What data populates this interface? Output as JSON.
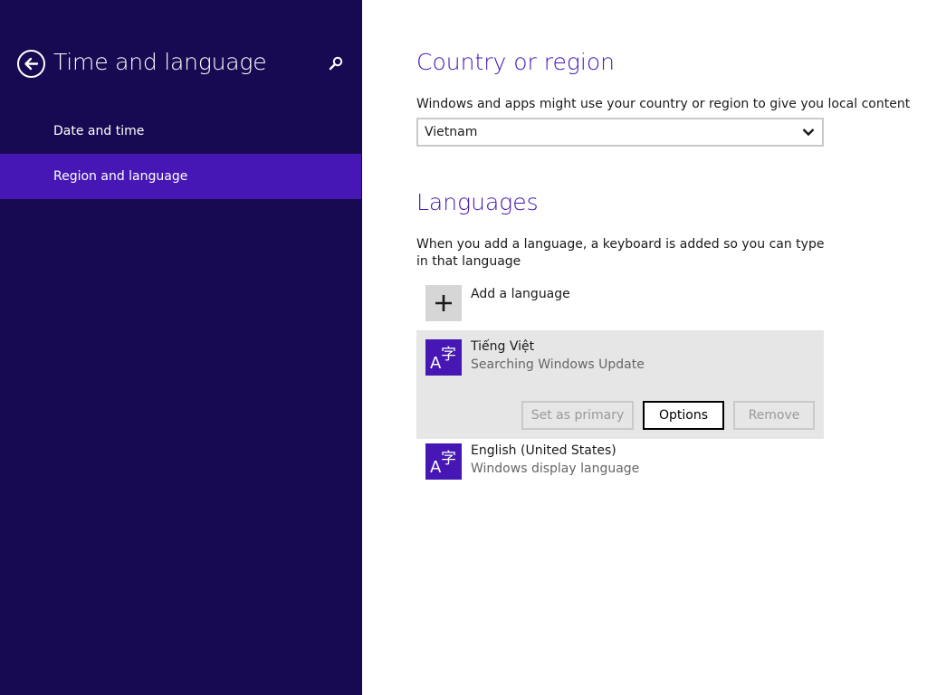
{
  "sidebar": {
    "title": "Time and language",
    "back_icon": "back-arrow-icon",
    "search_icon": "search-icon",
    "items": [
      {
        "label": "Date and time",
        "selected": false
      },
      {
        "label": "Region and language",
        "selected": true
      }
    ]
  },
  "country": {
    "heading": "Country or region",
    "description": "Windows and apps might use your country or region to give you local content",
    "selected_value": "Vietnam"
  },
  "languages": {
    "heading": "Languages",
    "description": "When you add a language, a keyboard is added so you can type in that language",
    "add_label": "Add a language",
    "items": [
      {
        "name": "Tiếng Việt",
        "status": "Searching Windows Update",
        "buttons": {
          "set_primary": "Set as primary",
          "options": "Options",
          "remove": "Remove"
        }
      },
      {
        "name": "English (United States)",
        "status": "Windows display language"
      }
    ]
  },
  "colors": {
    "sidebar_bg": "#180a52",
    "accent": "#4617b4",
    "selected_item_bg": "#e6e6e6"
  }
}
